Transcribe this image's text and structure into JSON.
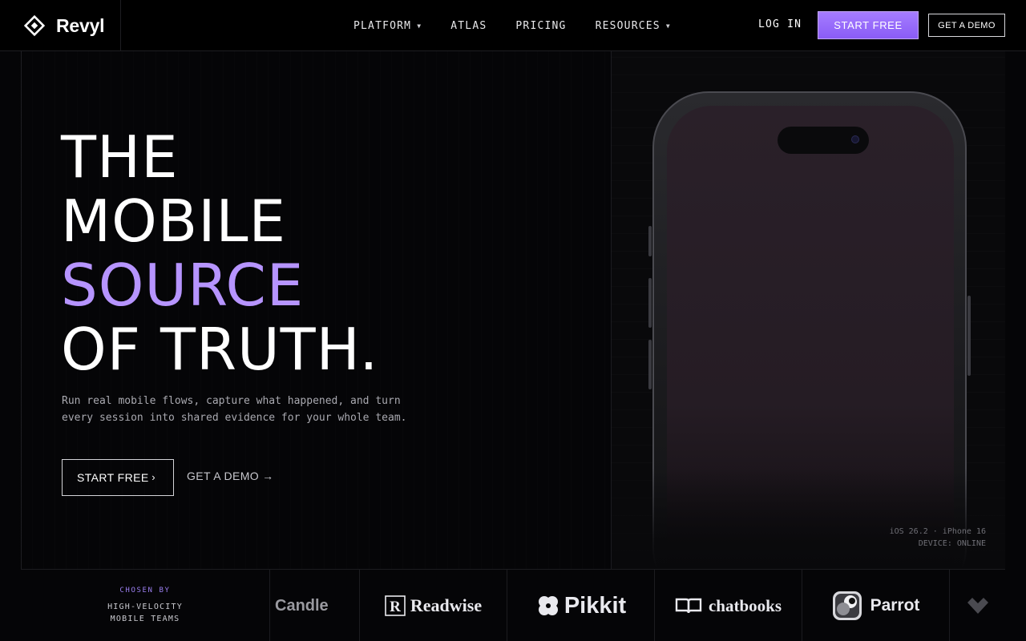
{
  "brand": {
    "name": "Revyl",
    "logo_icon": "diamond-logo-icon"
  },
  "nav": {
    "links": [
      {
        "label": "PLATFORM",
        "has_caret": true
      },
      {
        "label": "ATLAS",
        "has_caret": false
      },
      {
        "label": "PRICING",
        "has_caret": false
      },
      {
        "label": "RESOURCES",
        "has_caret": true
      }
    ],
    "login": "LOG IN",
    "start_free": "START FREE",
    "get_demo": "GET A DEMO"
  },
  "hero": {
    "line1": "THE",
    "line2": "MOBILE",
    "line3": "SOURCE",
    "line4": "OF TRUTH.",
    "subtext_line1": "Run real mobile flows, capture what happened, and turn",
    "subtext_line2": "every session into shared evidence for your whole team.",
    "cta_primary": "START FREE",
    "cta_secondary": "GET A DEMO",
    "cta_secondary_arrow": "→",
    "cta_primary_chevron": "›"
  },
  "device": {
    "os_line": "iOS 26.2 · iPhone 16",
    "status_line": "DEVICE: ONLINE"
  },
  "logos": {
    "kicker": "CHOSEN BY",
    "title_line1": "HIGH-VELOCITY",
    "title_line2": "MOBILE TEAMS",
    "items": [
      "Candle",
      "Readwise",
      "Pikkit",
      "chatbooks",
      "Parrot"
    ]
  },
  "colors": {
    "accent": "#b694ff",
    "button_purple": "#9a6dfb",
    "background": "#050507"
  }
}
